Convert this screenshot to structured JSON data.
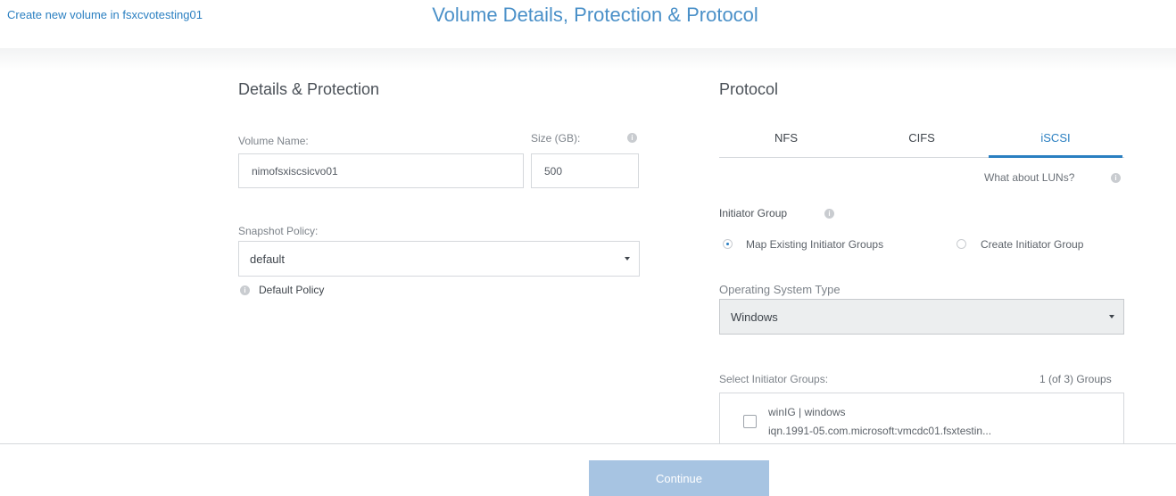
{
  "header": {
    "breadcrumb": "Create new volume in fsxcvotesting01",
    "title": "Volume Details, Protection & Protocol"
  },
  "details": {
    "section_title": "Details & Protection",
    "volume_name_label": "Volume Name:",
    "volume_name_value": "nimofsxiscsicvo01",
    "size_label": "Size (GB):",
    "size_value": "500",
    "snapshot_policy_label": "Snapshot Policy:",
    "snapshot_policy_value": "default",
    "snapshot_policy_help": "Default Policy"
  },
  "protocol": {
    "section_title": "Protocol",
    "tabs": [
      {
        "label": "NFS",
        "active": false
      },
      {
        "label": "CIFS",
        "active": false
      },
      {
        "label": "iSCSI",
        "active": true
      }
    ],
    "luns_link": "What about LUNs?",
    "initiator_group_label": "Initiator Group",
    "radio_options": [
      {
        "label": "Map Existing Initiator Groups",
        "checked": true
      },
      {
        "label": "Create Initiator Group",
        "checked": false
      }
    ],
    "os_type_label": "Operating System Type",
    "os_type_value": "Windows",
    "select_groups_label": "Select Initiator Groups:",
    "groups_count": "1 (of 3) Groups",
    "groups": [
      {
        "name": "winIG | windows",
        "iqn": "iqn.1991-05.com.microsoft:vmcdc01.fsxtestin..."
      }
    ]
  },
  "footer": {
    "continue_label": "Continue"
  },
  "colors": {
    "accent": "#2a7fc1",
    "title": "#4a90c8",
    "button_disabled": "#a7c4e2"
  }
}
